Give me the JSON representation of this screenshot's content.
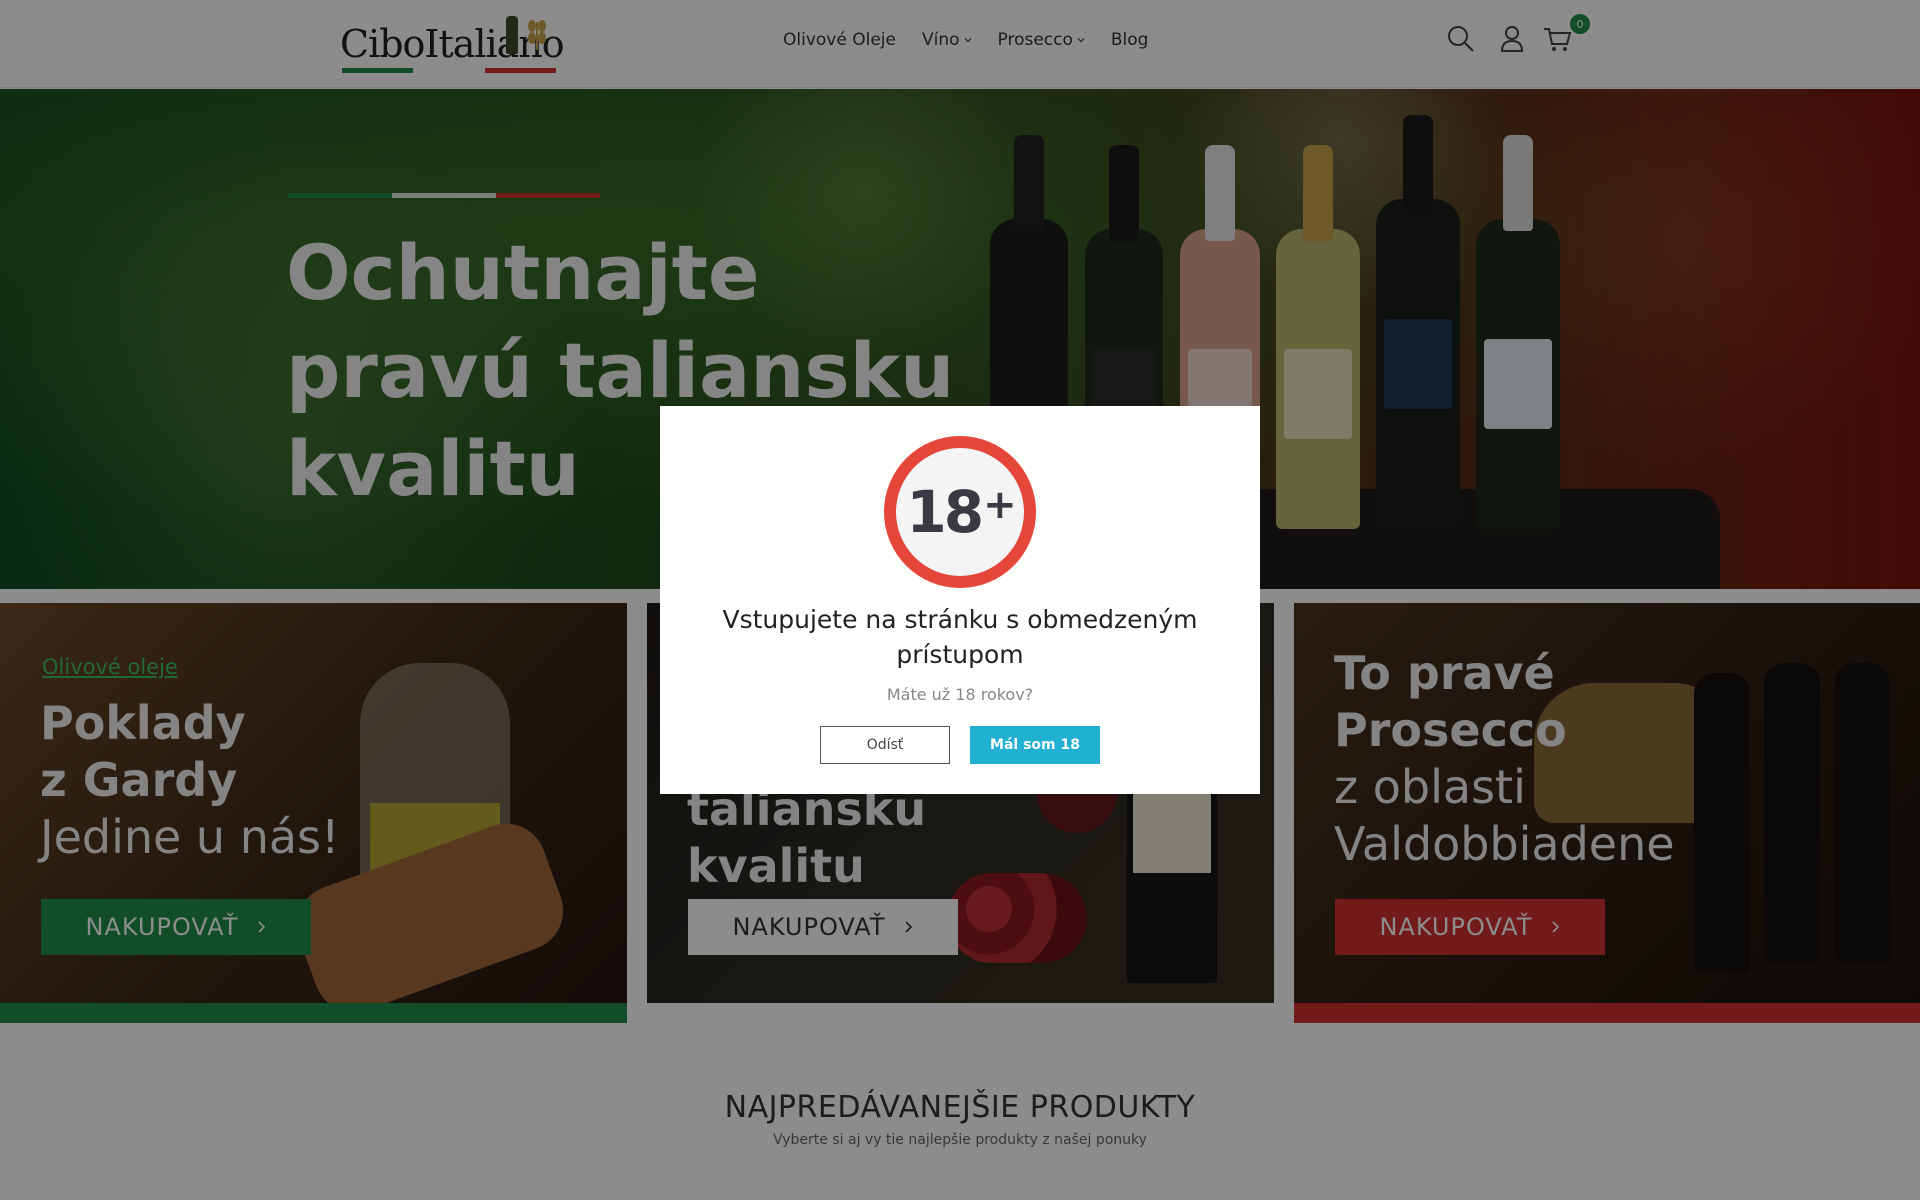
{
  "header": {
    "logo_text": "CiboItaliano",
    "nav": [
      {
        "label": "Olivové Oleje"
      },
      {
        "label": "Víno"
      },
      {
        "label": "Prosecco"
      },
      {
        "label": "Blog"
      }
    ],
    "cart_count": "0"
  },
  "hero": {
    "title_line1": "Ochutnajte",
    "title_line2": "pravú taliansku",
    "title_line3": "kvalitu"
  },
  "tiles": [
    {
      "kicker": "Olivové oleje",
      "bold_line1": "Poklady",
      "bold_line2": "z Gardy",
      "light_line": "Jedine u nás!",
      "button_label": "NAKUPOVAŤ"
    },
    {
      "bold_line1": "taliansku",
      "bold_line2": "kvalitu",
      "button_label": "NAKUPOVAŤ"
    },
    {
      "bold_line1": "To pravé",
      "bold_line2": "Prosecco",
      "light_line1": "z oblasti",
      "light_line2": "Valdobbiadene",
      "button_label": "NAKUPOVAŤ"
    }
  ],
  "section": {
    "title": "NAJPREDÁVANEJŠIE PRODUKTY",
    "subtitle": "Vyberte si aj vy tie najlepšie produkty z našej ponuky"
  },
  "modal": {
    "badge_text": "18",
    "badge_plus": "+",
    "title": "Vstupujete na stránku s obmedzeným prístupom",
    "question": "Máte už 18 rokov?",
    "leave_label": "Odísť",
    "enter_label": "Mál som 18"
  },
  "colors": {
    "brand_green": "#1e8c4a",
    "brand_red": "#d23030",
    "accent_cyan": "#21b0d1",
    "badge_red": "#e6453a"
  },
  "icons": [
    "search-icon",
    "user-icon",
    "cart-icon",
    "chevron-down-icon",
    "chevron-right-icon"
  ]
}
